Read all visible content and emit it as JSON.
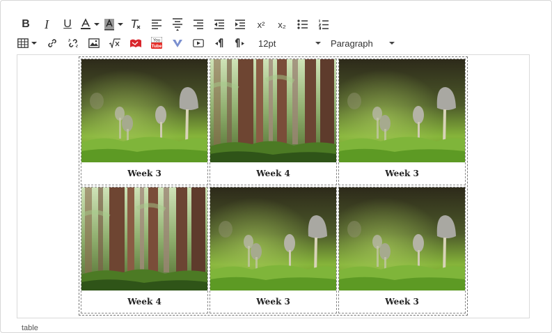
{
  "toolbar": {
    "row1": [
      {
        "name": "bold-button",
        "icon": "bold-icon",
        "glyph": "B"
      },
      {
        "name": "italic-button",
        "icon": "italic-icon",
        "glyph": "I"
      },
      {
        "name": "underline-button",
        "icon": "underline-icon",
        "glyph": "U"
      }
    ],
    "font_size": "12pt",
    "block_format": "Paragraph",
    "superscript_label": "x²",
    "subscript_label": "x₂"
  },
  "table": {
    "rows": [
      [
        {
          "caption": "Week 3",
          "image": "mushroom"
        },
        {
          "caption": "Week 4",
          "image": "forest"
        },
        {
          "caption": "Week 3",
          "image": "mushroom"
        }
      ],
      [
        {
          "caption": "Week 4",
          "image": "forest"
        },
        {
          "caption": "Week 3",
          "image": "mushroom"
        },
        {
          "caption": "Week 3",
          "image": "mushroom"
        }
      ]
    ]
  },
  "status_path": "table",
  "colors": {
    "accent_red": "#d9262c",
    "youtube_red": "#e52d27",
    "vimeo_blue": "#7a8fcf",
    "moss_green": "#7fb53a"
  }
}
